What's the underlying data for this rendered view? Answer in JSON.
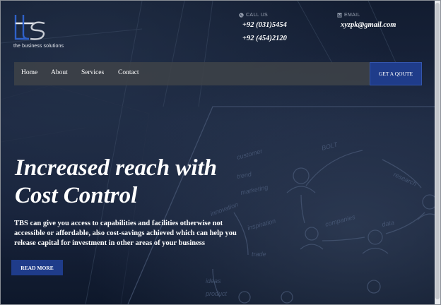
{
  "brand": {
    "logo_letters": "tbs",
    "tagline": "the business solutions"
  },
  "contact": {
    "call_label": "CALL US",
    "phones": [
      "+92 (031)5454",
      "+92 (454)2120"
    ],
    "email_label": "EMAIL",
    "email": "xyzpk@gmail.com"
  },
  "nav": {
    "items": [
      "Home",
      "About",
      "Services",
      "Contact"
    ],
    "quote_button": "GET A QOUTE"
  },
  "hero": {
    "headline_line1": "Increased reach with",
    "headline_line2": "Cost Control",
    "description": "TBS can give you access to capabilities and facilities otherwise not accessible or affordable, also cost-savings achieved which can help you release capital for investment in other areas of your business",
    "read_more": "READ MORE"
  },
  "colors": {
    "accent_blue": "#1f3c8a",
    "nav_bg": "#3e4248",
    "text_white": "#ffffff"
  }
}
